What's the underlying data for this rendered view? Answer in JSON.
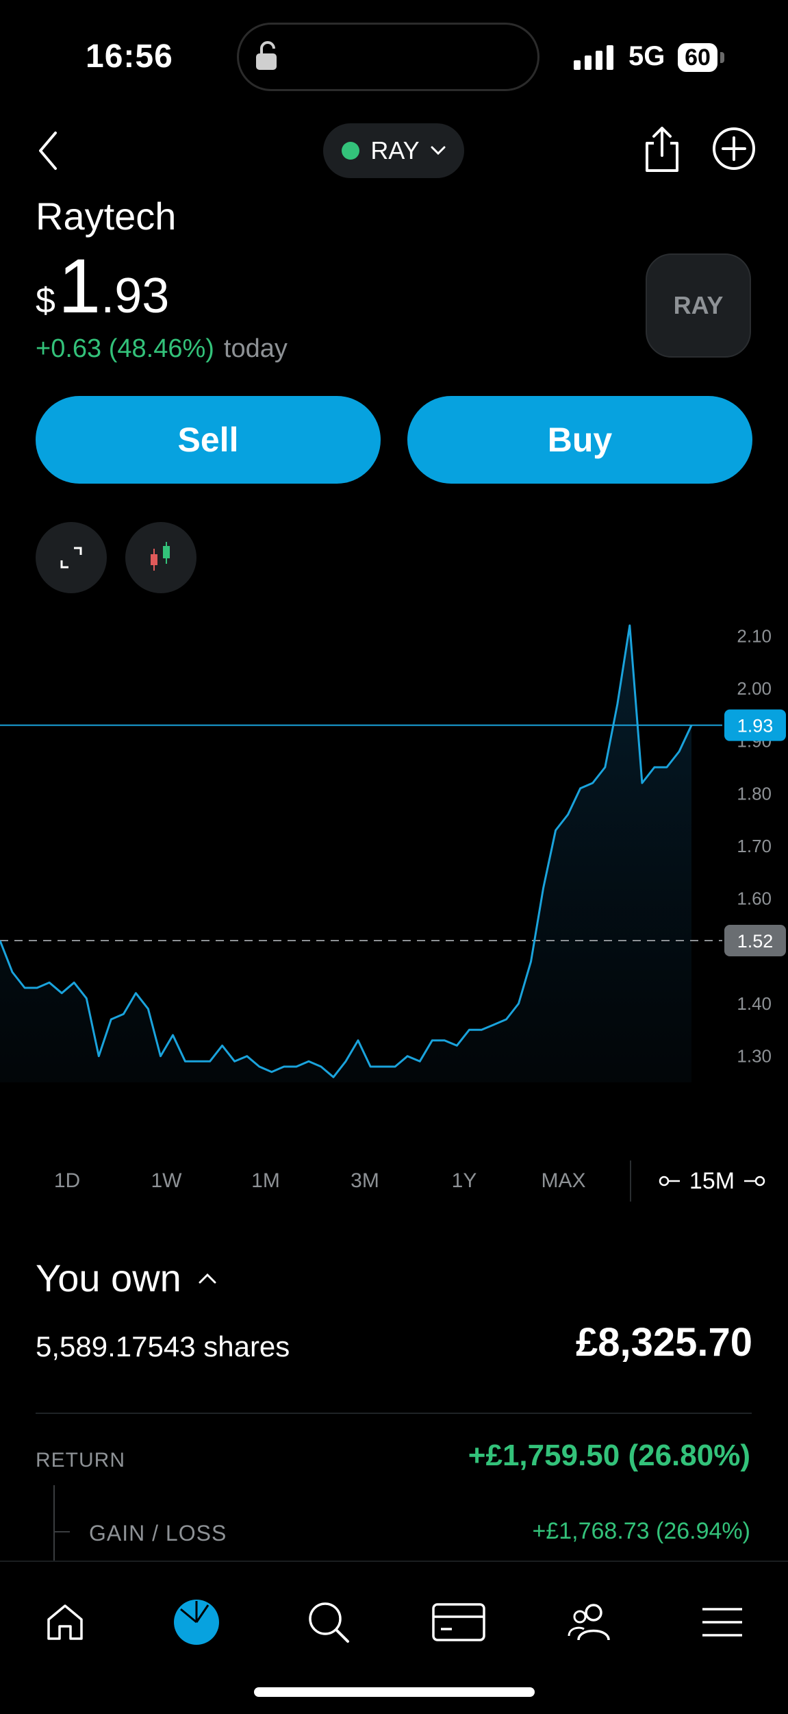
{
  "status_bar": {
    "time": "16:56",
    "network": "5G",
    "battery": "60"
  },
  "header": {
    "ticker": "RAY"
  },
  "stock": {
    "company": "Raytech",
    "currency_symbol": "$",
    "price_int": "1",
    "price_dec": ".93",
    "change": "+0.63 (48.46%)",
    "change_label": "today",
    "logo_text": "RAY"
  },
  "actions": {
    "sell": "Sell",
    "buy": "Buy"
  },
  "colors": {
    "accent": "#07a2df",
    "positive": "#33c27a",
    "surface": "#1c1f22"
  },
  "chart_data": {
    "type": "line",
    "y_ticks": [
      "2.10",
      "2.00",
      "1.90",
      "1.80",
      "1.70",
      "1.60",
      "1.40",
      "1.30"
    ],
    "ylim": [
      1.25,
      2.15
    ],
    "current_price_label": "1.93",
    "reference_price_label": "1.52",
    "current_price": 1.93,
    "reference_price": 1.52,
    "values": [
      1.52,
      1.46,
      1.43,
      1.43,
      1.44,
      1.42,
      1.44,
      1.41,
      1.3,
      1.37,
      1.38,
      1.42,
      1.39,
      1.3,
      1.34,
      1.29,
      1.29,
      1.29,
      1.32,
      1.29,
      1.3,
      1.28,
      1.27,
      1.28,
      1.28,
      1.29,
      1.28,
      1.26,
      1.29,
      1.33,
      1.28,
      1.28,
      1.28,
      1.3,
      1.29,
      1.33,
      1.33,
      1.32,
      1.35,
      1.35,
      1.36,
      1.37,
      1.4,
      1.48,
      1.62,
      1.73,
      1.76,
      1.81,
      1.82,
      1.85,
      1.97,
      2.12,
      1.82,
      1.85,
      1.85,
      1.88,
      1.93
    ]
  },
  "ranges": {
    "tabs": [
      "1D",
      "1W",
      "1M",
      "3M",
      "1Y",
      "MAX"
    ],
    "active": "1D",
    "interval": "15M"
  },
  "holdings": {
    "title": "You own",
    "shares": "5,589.17543 shares",
    "value": "£8,325.70",
    "return_label": "RETURN",
    "return_value": "+£1,759.50 (26.80%)",
    "gain_loss_label": "GAIN / LOSS",
    "gain_loss_value": "+£1,768.73 (26.94%)"
  },
  "nav": {
    "items": [
      {
        "icon": "home-icon"
      },
      {
        "icon": "portfolio-pie-icon"
      },
      {
        "icon": "search-icon"
      },
      {
        "icon": "card-icon"
      },
      {
        "icon": "people-icon"
      },
      {
        "icon": "menu-icon"
      }
    ]
  }
}
